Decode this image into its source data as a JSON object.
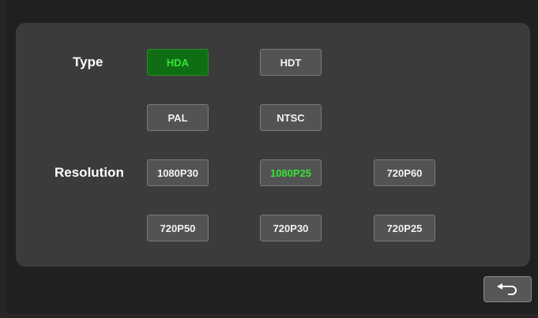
{
  "labels": {
    "type": "Type",
    "resolution": "Resolution"
  },
  "type_options": [
    {
      "label": "HDA",
      "selected": true
    },
    {
      "label": "HDT",
      "selected": false
    },
    {
      "label": "PAL",
      "selected": false
    },
    {
      "label": "NTSC",
      "selected": false
    }
  ],
  "resolution_options": [
    {
      "label": "1080P30",
      "selected": false
    },
    {
      "label": "1080P25",
      "selected": true
    },
    {
      "label": "720P60",
      "selected": false
    },
    {
      "label": "720P50",
      "selected": false
    },
    {
      "label": "720P30",
      "selected": false
    },
    {
      "label": "720P25",
      "selected": false
    }
  ],
  "back_icon": "return-arrow-icon",
  "colors": {
    "selected_text": "#36e336",
    "selected_bg": "#0f6e14",
    "panel": "#3b3b3b"
  }
}
